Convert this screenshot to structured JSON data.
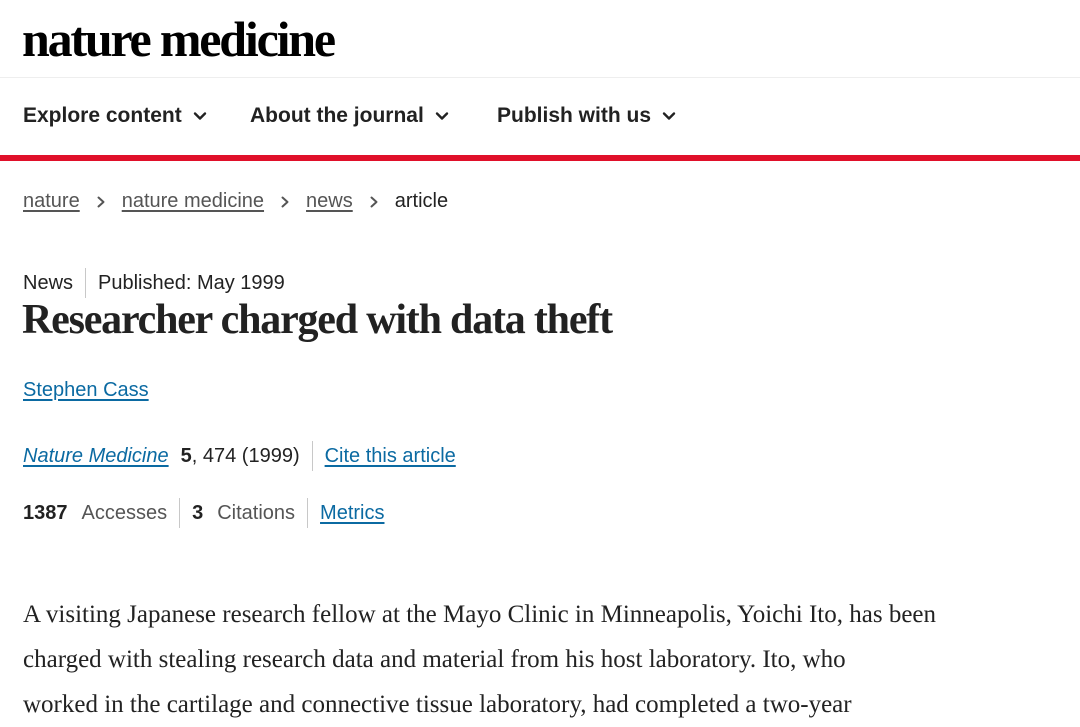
{
  "site": {
    "logo": "nature medicine"
  },
  "nav": {
    "items": [
      {
        "label": "Explore content"
      },
      {
        "label": "About the journal"
      },
      {
        "label": "Publish with us"
      }
    ]
  },
  "breadcrumb": {
    "items": [
      "nature",
      "nature medicine",
      "news"
    ],
    "current": "article"
  },
  "article": {
    "type": "News",
    "published": "Published: May 1999",
    "title": "Researcher charged with data theft",
    "author": "Stephen Cass",
    "journal": "Nature Medicine",
    "volume": "5",
    "pages_year": ", 474 (1999)",
    "cite_label": "Cite this article",
    "accesses_count": "1387",
    "accesses_label": "Accesses",
    "citations_count": "3",
    "citations_label": "Citations",
    "metrics_label": "Metrics",
    "body_lines": [
      "A visiting Japanese research fellow at the Mayo Clinic in Minneapolis, Yoichi Ito, has been",
      "charged with stealing research data and material from his host laboratory. Ito, who",
      "worked in the cartilage and connective tissue laboratory, had completed a two-year"
    ]
  },
  "colors": {
    "accent": "#e0102a",
    "link": "#0b6aa2",
    "text": "#222222"
  },
  "icons": {
    "nav_dropdown": "chevron-down-icon",
    "breadcrumb_sep": "chevron-right-icon"
  }
}
